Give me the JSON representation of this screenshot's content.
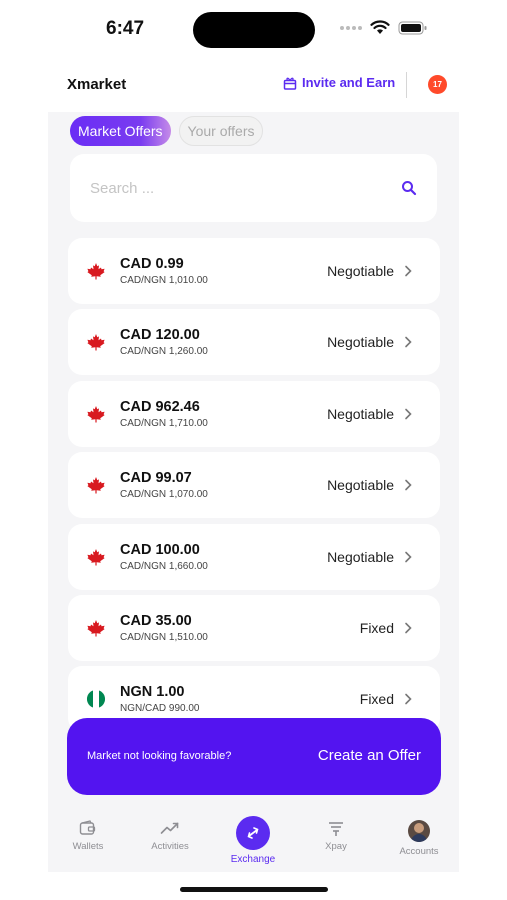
{
  "status": {
    "time": "6:47"
  },
  "header": {
    "title": "Xmarket",
    "invite_label": "Invite and Earn",
    "notification_count": "17"
  },
  "tabs": [
    {
      "label": "Market Offers",
      "active": true
    },
    {
      "label": "Your offers",
      "active": false
    }
  ],
  "search": {
    "placeholder": "Search ...",
    "value": ""
  },
  "offers": [
    {
      "flag": "canada",
      "amount": "CAD 0.99",
      "rate": "CAD/NGN 1,010.00",
      "type": "Negotiable"
    },
    {
      "flag": "canada",
      "amount": "CAD 120.00",
      "rate": "CAD/NGN 1,260.00",
      "type": "Negotiable"
    },
    {
      "flag": "canada",
      "amount": "CAD 962.46",
      "rate": "CAD/NGN 1,710.00",
      "type": "Negotiable"
    },
    {
      "flag": "canada",
      "amount": "CAD 99.07",
      "rate": "CAD/NGN 1,070.00",
      "type": "Negotiable"
    },
    {
      "flag": "canada",
      "amount": "CAD 100.00",
      "rate": "CAD/NGN 1,660.00",
      "type": "Negotiable"
    },
    {
      "flag": "canada",
      "amount": "CAD 35.00",
      "rate": "CAD/NGN 1,510.00",
      "type": "Fixed"
    },
    {
      "flag": "nigeria",
      "amount": "NGN 1.00",
      "rate": "NGN/CAD 990.00",
      "type": "Fixed"
    }
  ],
  "cta": {
    "message": "Market not looking favorable?",
    "button_label": "Create an Offer"
  },
  "tabbar": [
    {
      "label": "Wallets",
      "icon": "wallet-icon",
      "active": false
    },
    {
      "label": "Activities",
      "icon": "activity-icon",
      "active": false
    },
    {
      "label": "Exchange",
      "icon": "exchange-icon",
      "active": true
    },
    {
      "label": "Xpay",
      "icon": "xpay-icon",
      "active": false
    },
    {
      "label": "Accounts",
      "icon": "avatar",
      "active": false
    }
  ],
  "colors": {
    "accent": "#5B2BF0",
    "cta": "#5314F0",
    "badge": "#FF4A2A",
    "maple": "#D8191F",
    "nigeria_green": "#008751"
  }
}
